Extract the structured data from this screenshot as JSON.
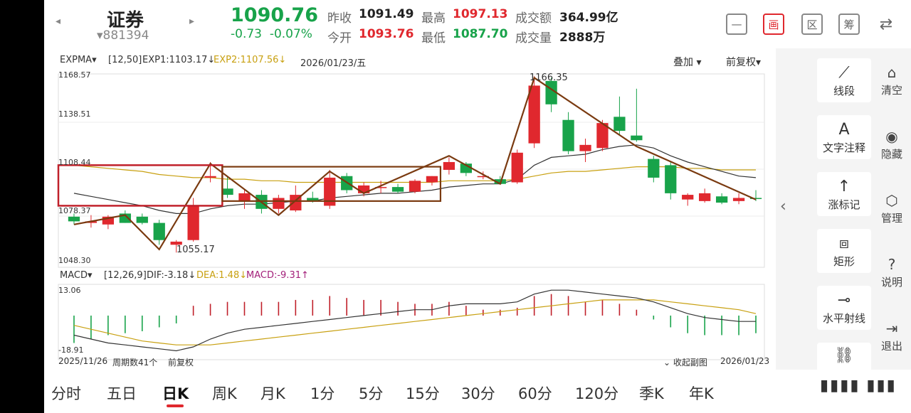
{
  "header": {
    "prev_arrow": "◂",
    "next_arrow": "▸",
    "name": "证券",
    "code": "▾881394",
    "price": "1090.76",
    "change": "-0.73",
    "change_pct": "-0.07%",
    "quotes": {
      "prev_close_label": "昨收",
      "prev_close": "1091.49",
      "open_label": "今开",
      "open": "1093.76",
      "high_label": "最高",
      "high": "1097.13",
      "low_label": "最低",
      "low": "1087.70",
      "amount_label": "成交额",
      "amount": "364.99亿",
      "volume_label": "成交量",
      "volume": "2888万"
    },
    "toolbar": {
      "minus": "—",
      "draw": "画",
      "zone": "区",
      "chip": "筹",
      "phone": "⇄"
    }
  },
  "chart": {
    "exp_indicator": "EXPMA▾",
    "exp_params": "[12,50]",
    "exp1": "EXP1:1103.17↓",
    "exp2": "EXP2:1107.56↓",
    "date": "2026/01/23/五",
    "overlay": "叠加 ▾",
    "adjust": "前复权▾",
    "y_ticks": [
      "1168.57",
      "1138.51",
      "1108.44",
      "1078.37",
      "1048.30"
    ],
    "high_label": "1166.35",
    "low_label": "1055.17",
    "macd_indicator": "MACD▾",
    "macd_params": "[12,26,9]",
    "dif": "DIF:-3.18↓",
    "dea": "DEA:1.48↓",
    "macd": "MACD:-9.31↑",
    "macd_top": "13.06",
    "macd_bottom": "-18.91",
    "start_date": "2025/11/26",
    "period_count": "周期数41个",
    "adjust_bottom": "前复权",
    "collapse_sub": "⌄ 收起副图",
    "end_date": "2026/01/23"
  },
  "chart_data": {
    "type": "candlestick",
    "ylim": [
      1048.3,
      1168.57
    ],
    "candles": [
      {
        "o": 1078,
        "h": 1080,
        "l": 1073,
        "c": 1075,
        "color": "green"
      },
      {
        "o": 1074,
        "h": 1079,
        "l": 1071,
        "c": 1075,
        "color": "red"
      },
      {
        "o": 1073,
        "h": 1079,
        "l": 1070,
        "c": 1078,
        "color": "red"
      },
      {
        "o": 1080,
        "h": 1082,
        "l": 1074,
        "c": 1074,
        "color": "green"
      },
      {
        "o": 1078,
        "h": 1080,
        "l": 1073,
        "c": 1074,
        "color": "green"
      },
      {
        "o": 1074,
        "h": 1076,
        "l": 1060,
        "c": 1063,
        "color": "green"
      },
      {
        "o": 1060,
        "h": 1063,
        "l": 1055,
        "c": 1062,
        "color": "red"
      },
      {
        "o": 1063,
        "h": 1090,
        "l": 1062,
        "c": 1085,
        "color": "red"
      },
      {
        "o": 1103,
        "h": 1113,
        "l": 1100,
        "c": 1104,
        "color": "red"
      },
      {
        "o": 1096,
        "h": 1104,
        "l": 1090,
        "c": 1092,
        "color": "green"
      },
      {
        "o": 1088,
        "h": 1095,
        "l": 1083,
        "c": 1093,
        "color": "red"
      },
      {
        "o": 1092,
        "h": 1095,
        "l": 1080,
        "c": 1083,
        "color": "green"
      },
      {
        "o": 1083,
        "h": 1092,
        "l": 1080,
        "c": 1090,
        "color": "red"
      },
      {
        "o": 1082,
        "h": 1098,
        "l": 1081,
        "c": 1092,
        "color": "red"
      },
      {
        "o": 1090,
        "h": 1094,
        "l": 1087,
        "c": 1088,
        "color": "green"
      },
      {
        "o": 1085,
        "h": 1108,
        "l": 1083,
        "c": 1103,
        "color": "red"
      },
      {
        "o": 1104,
        "h": 1106,
        "l": 1093,
        "c": 1095,
        "color": "green"
      },
      {
        "o": 1093,
        "h": 1100,
        "l": 1091,
        "c": 1098,
        "color": "red"
      },
      {
        "o": 1097,
        "h": 1101,
        "l": 1093,
        "c": 1097,
        "color": "red"
      },
      {
        "o": 1097,
        "h": 1099,
        "l": 1093,
        "c": 1094,
        "color": "green"
      },
      {
        "o": 1094,
        "h": 1102,
        "l": 1093,
        "c": 1101,
        "color": "red"
      },
      {
        "o": 1100,
        "h": 1104,
        "l": 1098,
        "c": 1104,
        "color": "red"
      },
      {
        "o": 1108,
        "h": 1116,
        "l": 1105,
        "c": 1113,
        "color": "red"
      },
      {
        "o": 1112,
        "h": 1113,
        "l": 1104,
        "c": 1106,
        "color": "green"
      },
      {
        "o": 1104,
        "h": 1107,
        "l": 1102,
        "c": 1104,
        "color": "red"
      },
      {
        "o": 1102,
        "h": 1104,
        "l": 1099,
        "c": 1099,
        "color": "green"
      },
      {
        "o": 1100,
        "h": 1121,
        "l": 1099,
        "c": 1119,
        "color": "red"
      },
      {
        "o": 1125,
        "h": 1168,
        "l": 1122,
        "c": 1162,
        "color": "red"
      },
      {
        "o": 1165,
        "h": 1167,
        "l": 1145,
        "c": 1150,
        "color": "green"
      },
      {
        "o": 1140,
        "h": 1145,
        "l": 1118,
        "c": 1120,
        "color": "green"
      },
      {
        "o": 1120,
        "h": 1128,
        "l": 1113,
        "c": 1124,
        "color": "red"
      },
      {
        "o": 1122,
        "h": 1140,
        "l": 1120,
        "c": 1138,
        "color": "red"
      },
      {
        "o": 1142,
        "h": 1155,
        "l": 1130,
        "c": 1133,
        "color": "green"
      },
      {
        "o": 1130,
        "h": 1160,
        "l": 1126,
        "c": 1127,
        "color": "green"
      },
      {
        "o": 1115,
        "h": 1117,
        "l": 1100,
        "c": 1103,
        "color": "green"
      },
      {
        "o": 1111,
        "h": 1113,
        "l": 1089,
        "c": 1093,
        "color": "green"
      },
      {
        "o": 1089,
        "h": 1093,
        "l": 1085,
        "c": 1092,
        "color": "red"
      },
      {
        "o": 1093,
        "h": 1096,
        "l": 1087,
        "c": 1088,
        "color": "red"
      },
      {
        "o": 1091,
        "h": 1093,
        "l": 1086,
        "c": 1087,
        "color": "green"
      },
      {
        "o": 1088,
        "h": 1093,
        "l": 1086,
        "c": 1090,
        "color": "red"
      },
      {
        "o": 1090,
        "h": 1095,
        "l": 1088,
        "c": 1090,
        "color": "green"
      }
    ],
    "exp1": [
      1093,
      1091,
      1089,
      1087,
      1085,
      1082,
      1080,
      1080,
      1083,
      1085,
      1086,
      1086,
      1087,
      1088,
      1088,
      1090,
      1091,
      1092,
      1093,
      1093,
      1094,
      1095,
      1097,
      1098,
      1099,
      1099,
      1102,
      1111,
      1116,
      1117,
      1118,
      1121,
      1123,
      1124,
      1122,
      1117,
      1113,
      1110,
      1107,
      1104,
      1103
    ],
    "exp2": [
      1111,
      1110,
      1109,
      1108,
      1107,
      1105,
      1104,
      1103,
      1103,
      1102,
      1102,
      1101,
      1101,
      1100,
      1100,
      1100,
      1100,
      1100,
      1100,
      1100,
      1100,
      1100,
      1101,
      1101,
      1101,
      1101,
      1102,
      1104,
      1106,
      1107,
      1107,
      1108,
      1109,
      1110,
      1110,
      1110,
      1109,
      1109,
      1108,
      1108,
      1108
    ],
    "macd_bars": [
      -14,
      -12,
      -10,
      -9,
      -8,
      -6,
      -4,
      5,
      6,
      7,
      7,
      7,
      7,
      8,
      8,
      10,
      9,
      8,
      8,
      7,
      6,
      6,
      7,
      5,
      3,
      3,
      4,
      10,
      11,
      10,
      7,
      8,
      6,
      3,
      -2,
      -6,
      -9,
      -10,
      -10,
      -10,
      -9
    ],
    "dif": [
      -10,
      -12,
      -14,
      -15,
      -16,
      -17,
      -18,
      -16,
      -12,
      -9,
      -7,
      -6,
      -5,
      -4,
      -3,
      -2,
      -1,
      0,
      1,
      2,
      3,
      3,
      5,
      6,
      6,
      6,
      7,
      11,
      13,
      13,
      12,
      11,
      10,
      9,
      7,
      4,
      1,
      -1,
      -2,
      -3,
      -3
    ],
    "dea": [
      -5,
      -7,
      -9,
      -11,
      -13,
      -14,
      -15,
      -15,
      -15,
      -14,
      -13,
      -12,
      -11,
      -10,
      -9,
      -8,
      -7,
      -6,
      -5,
      -4,
      -3,
      -2,
      -1,
      0,
      1,
      2,
      3,
      4,
      5,
      6,
      7,
      8,
      8,
      8,
      8,
      7,
      6,
      5,
      4,
      3,
      1
    ],
    "macd_ylim": [
      -18.91,
      13.06
    ]
  },
  "tools": {
    "items": [
      {
        "icon": "⟋",
        "label": "线段"
      },
      {
        "icon": "A",
        "label": "文字注释"
      },
      {
        "icon": "↑",
        "label": "涨标记"
      },
      {
        "icon": "⧈",
        "label": "矩形"
      },
      {
        "icon": "⊸",
        "label": "水平射线"
      },
      {
        "icon": "⛓",
        "label": ""
      }
    ],
    "side": [
      {
        "icon": "⌂",
        "label": "清空"
      },
      {
        "icon": "◉",
        "label": "隐藏"
      },
      {
        "icon": "⬡",
        "label": "管理"
      },
      {
        "icon": "?",
        "label": "说明"
      },
      {
        "icon": "⇥",
        "label": "退出"
      }
    ],
    "collapse": "‹"
  },
  "tabs": [
    "分时",
    "五日",
    "日K",
    "周K",
    "月K",
    "1分",
    "5分",
    "15分",
    "30分",
    "60分",
    "120分",
    "季K",
    "年K"
  ],
  "active_tab": "日K",
  "pager": "▮▮▮▮ ▮▮▮"
}
